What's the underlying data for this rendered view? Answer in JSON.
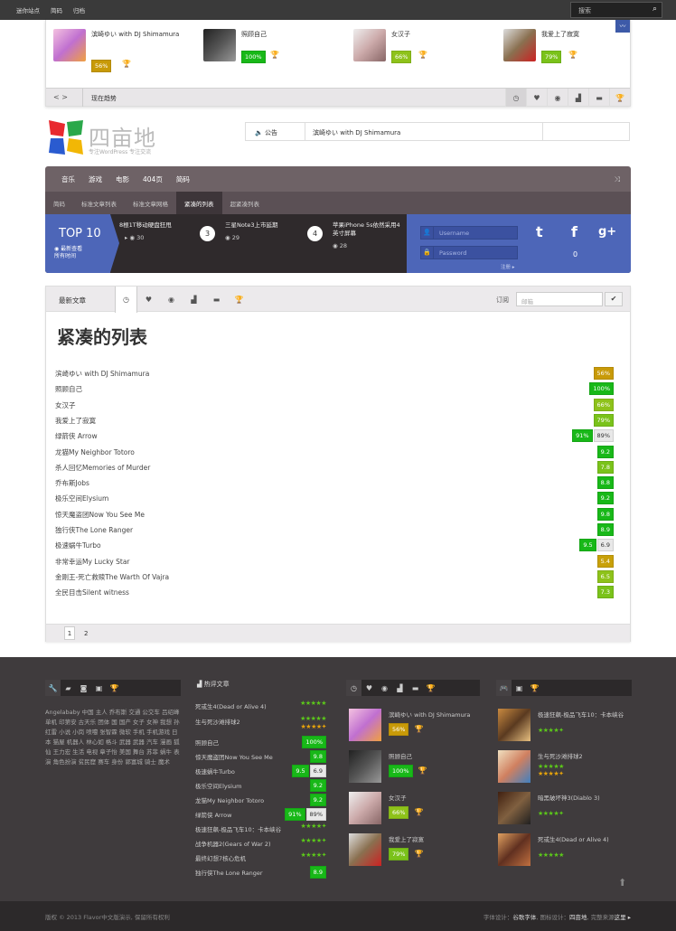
{
  "topbar": {
    "menu": [
      "迷你站点",
      "简码",
      "归档"
    ],
    "search_placeholder": "搜索"
  },
  "slider": {
    "items": [
      {
        "title": "滨崎ゆい with DJ Shimamura",
        "pct": "56%",
        "color": "#c89a08"
      },
      {
        "title": "照顾自己",
        "pct": "100%",
        "color": "#18b818"
      },
      {
        "title": "女汉子",
        "pct": "66%",
        "color": "#8ec21a"
      },
      {
        "title": "我爱上了寂寞",
        "pct": "79%",
        "color": "#7ac21a"
      }
    ],
    "nav": "< >",
    "bar_label": "现在趋势"
  },
  "logo": {
    "title": "四亩地",
    "sub": "专注WordPress 专注交流"
  },
  "notice": {
    "label": "公告",
    "text": "滨崎ゆい with DJ Shimamura"
  },
  "nav": {
    "main": [
      "音乐",
      "游戏",
      "电影",
      "404页",
      "简码"
    ],
    "sub": [
      "简码",
      "标准文章列表",
      "标准文章网格",
      "紧凑的列表",
      "超紧凑列表"
    ]
  },
  "featured": {
    "title": "TOP 10",
    "sub1": "最新查看",
    "sub2": "所有时间",
    "items": [
      {
        "num": "",
        "title": "8根1T移动硬盘狂甩",
        "views": "30"
      },
      {
        "num": "3",
        "title": "三星Note3上市延期",
        "views": "29"
      },
      {
        "num": "4",
        "title": "苹果iPhone 5s依然采用4英寸屏幕",
        "views": "28"
      }
    ]
  },
  "login": {
    "user_placeholder": "Username",
    "pass_placeholder": "Password",
    "register": "注册 ▸"
  },
  "social": {
    "twitter": "t",
    "facebook": "f",
    "gplus": "g+",
    "count": "0"
  },
  "list": {
    "tab_title": "最新文章",
    "subscribe": "订阅",
    "email_placeholder": "邮箱",
    "heading": "紧凑的列表",
    "rows": [
      {
        "name": "滨崎ゆい with DJ Shimamura",
        "badges": [
          {
            "t": "56%",
            "c": "#c89a08"
          }
        ]
      },
      {
        "name": "照顾自己",
        "badges": [
          {
            "t": "100%",
            "c": "#18b818"
          }
        ]
      },
      {
        "name": "女汉子",
        "badges": [
          {
            "t": "66%",
            "c": "#8ec21a"
          }
        ]
      },
      {
        "name": "我爱上了寂寞",
        "badges": [
          {
            "t": "79%",
            "c": "#7ac21a"
          }
        ]
      },
      {
        "name": "绿箭侠 Arrow",
        "badges": [
          {
            "t": "91%",
            "c": "#18b818"
          },
          {
            "t": "89%",
            "c": "#e8e8e8"
          }
        ]
      },
      {
        "name": "龙猫My Neighbor Totoro",
        "badges": [
          {
            "t": "9.2",
            "c": "#18b818"
          }
        ]
      },
      {
        "name": "杀人回忆Memories of Murder",
        "badges": [
          {
            "t": "7.8",
            "c": "#7ac21a"
          }
        ]
      },
      {
        "name": "乔布斯Jobs",
        "badges": [
          {
            "t": "8.8",
            "c": "#18b818"
          }
        ]
      },
      {
        "name": "极乐空间Elysium",
        "badges": [
          {
            "t": "9.2",
            "c": "#18b818"
          }
        ]
      },
      {
        "name": "惊天魔盗团Now You See Me",
        "badges": [
          {
            "t": "9.8",
            "c": "#18b818"
          }
        ]
      },
      {
        "name": "独行侠The Lone Ranger",
        "badges": [
          {
            "t": "8.9",
            "c": "#18b818"
          }
        ]
      },
      {
        "name": "极速蜗牛Turbo",
        "badges": [
          {
            "t": "9.5",
            "c": "#18b818"
          },
          {
            "t": "6.9",
            "c": "#e8e8e8"
          }
        ]
      },
      {
        "name": "非常幸运My Lucky Star",
        "badges": [
          {
            "t": "5.4",
            "c": "#c8a008"
          }
        ]
      },
      {
        "name": "金刚王-死亡救赎The Warth Of Vajra",
        "badges": [
          {
            "t": "6.5",
            "c": "#8ec21a"
          }
        ]
      },
      {
        "name": "全民目击Silent witness",
        "badges": [
          {
            "t": "7.3",
            "c": "#7ac21a"
          }
        ]
      }
    ],
    "pages": [
      "1",
      "2"
    ]
  },
  "footer": {
    "tags": "Angelababy 中国 主人 乔布斯 交通 公交车 吕绍峰 单机 印第安 古天乐 团体 国 国产 女子 女神 我想 孙红雷 小说 小岗 喷嚏 张智霖 微软 手机 手机游戏 日本 猫屋 机器人 林心如 格斗 武器 武器 汽车 漫画 狐仙 王力宏 生活 电视 章子怡 美国 舞台 苏菲 蜗牛 表演 角色扮演 贫民窟 赛车 身份 郭富城 骑士 魔术",
    "hot_title": "热评文章",
    "hot": [
      {
        "name": "死或生4(Dead or Alive 4)",
        "stars": "★★★★★",
        "badge": null
      },
      {
        "name": "生与死沙滩排球2",
        "stars": "★★★★★",
        "stars2": "★★★★✦",
        "badge": null
      },
      {
        "name": "照顾自己",
        "badge": {
          "t": "100%",
          "c": "#18b818"
        }
      },
      {
        "name": "惊天魔盗团Now You See Me",
        "badge": {
          "t": "9.8",
          "c": "#18b818"
        }
      },
      {
        "name": "极速蜗牛Turbo",
        "badge": {
          "t": "9.5",
          "c": "#18b818"
        },
        "badge2": {
          "t": "6.9",
          "c": "#e8e8e8"
        }
      },
      {
        "name": "极乐空间Elysium",
        "badge": {
          "t": "9.2",
          "c": "#18b818"
        }
      },
      {
        "name": "龙猫My Neighbor Totoro",
        "badge": {
          "t": "9.2",
          "c": "#18b818"
        }
      },
      {
        "name": "绿箭侠 Arrow",
        "badge": {
          "t": "91%",
          "c": "#18b818"
        },
        "badge2": {
          "t": "89%",
          "c": "#e8e8e8"
        }
      },
      {
        "name": "极速狂飙-极品飞车10：卡本峡谷",
        "stars": "★★★★✦"
      },
      {
        "name": "战争机器2(Gears of War 2)",
        "stars": "★★★★✦"
      },
      {
        "name": "最终幻想7核心危机",
        "stars": "★★★★✦"
      },
      {
        "name": "独行侠The Lone Ranger",
        "badge": {
          "t": "8.9",
          "c": "#18b818"
        }
      }
    ],
    "col3": [
      {
        "title": "滨崎ゆい with DJ Shimamura",
        "pct": "56%",
        "c": "#c89a08"
      },
      {
        "title": "照顾自己",
        "pct": "100%",
        "c": "#18b818"
      },
      {
        "title": "女汉子",
        "pct": "66%",
        "c": "#8ec21a"
      },
      {
        "title": "我爱上了寂寞",
        "pct": "79%",
        "c": "#7ac21a"
      }
    ],
    "col4": [
      {
        "title": "极速狂飙-极品飞车10：卡本峡谷",
        "stars": "★★★★✦"
      },
      {
        "title": "生与死沙滩排球2",
        "stars": "★★★★★",
        "stars2": "★★★★✦"
      },
      {
        "title": "暗黑破坏神3(Diablo 3)",
        "stars": "★★★★✦"
      },
      {
        "title": "死或生4(Dead or Alive 4)",
        "stars": "★★★★★"
      }
    ]
  },
  "copyright": {
    "left": "版权 © 2013 Flavor中文版演示, 保留所有权利",
    "right_label1": "字体设计：",
    "right_v1": "谷歌字体",
    "right_label2": "图标设计：",
    "right_v2": "四亩地",
    "right_label3": "完整来源",
    "right_v3": "这里 ▸"
  }
}
